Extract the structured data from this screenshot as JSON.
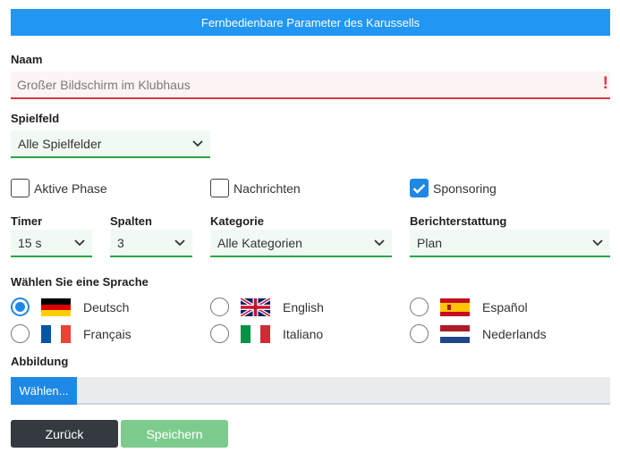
{
  "header": {
    "title": "Fernbedienbare Parameter des Karussells"
  },
  "name": {
    "label": "Naam",
    "placeholder": "Großer Bildschirm im Klubhaus",
    "error_mark": "!"
  },
  "spielfeld": {
    "label": "Spielfeld",
    "value": "Alle Spielfelder"
  },
  "checkboxes": [
    {
      "label": "Aktive Phase",
      "checked": false
    },
    {
      "label": "Nachrichten",
      "checked": false
    },
    {
      "label": "Sponsoring",
      "checked": true
    }
  ],
  "timer": {
    "label": "Timer",
    "value": "15 s"
  },
  "spalten": {
    "label": "Spalten",
    "value": "3"
  },
  "kategorie": {
    "label": "Kategorie",
    "value": "Alle Kategorien"
  },
  "berichterstattung": {
    "label": "Berichterstattung",
    "value": "Plan"
  },
  "language": {
    "label": "Wählen Sie eine Sprache",
    "options": [
      {
        "label": "Deutsch",
        "flag": "de-flag-icon",
        "selected": true
      },
      {
        "label": "English",
        "flag": "uk-flag-icon",
        "selected": false
      },
      {
        "label": "Español",
        "flag": "es-flag-icon",
        "selected": false
      },
      {
        "label": "Français",
        "flag": "fr-flag-icon",
        "selected": false
      },
      {
        "label": "Italiano",
        "flag": "it-flag-icon",
        "selected": false
      },
      {
        "label": "Nederlands",
        "flag": "nl-flag-icon",
        "selected": false
      }
    ]
  },
  "abbildung": {
    "label": "Abbildung",
    "button": "Wählen..."
  },
  "buttons": {
    "back": "Zurück",
    "save": "Speichern"
  },
  "colors": {
    "primary": "#2196f3",
    "error": "#dc3545",
    "success": "#28a745",
    "dark": "#343a40"
  }
}
